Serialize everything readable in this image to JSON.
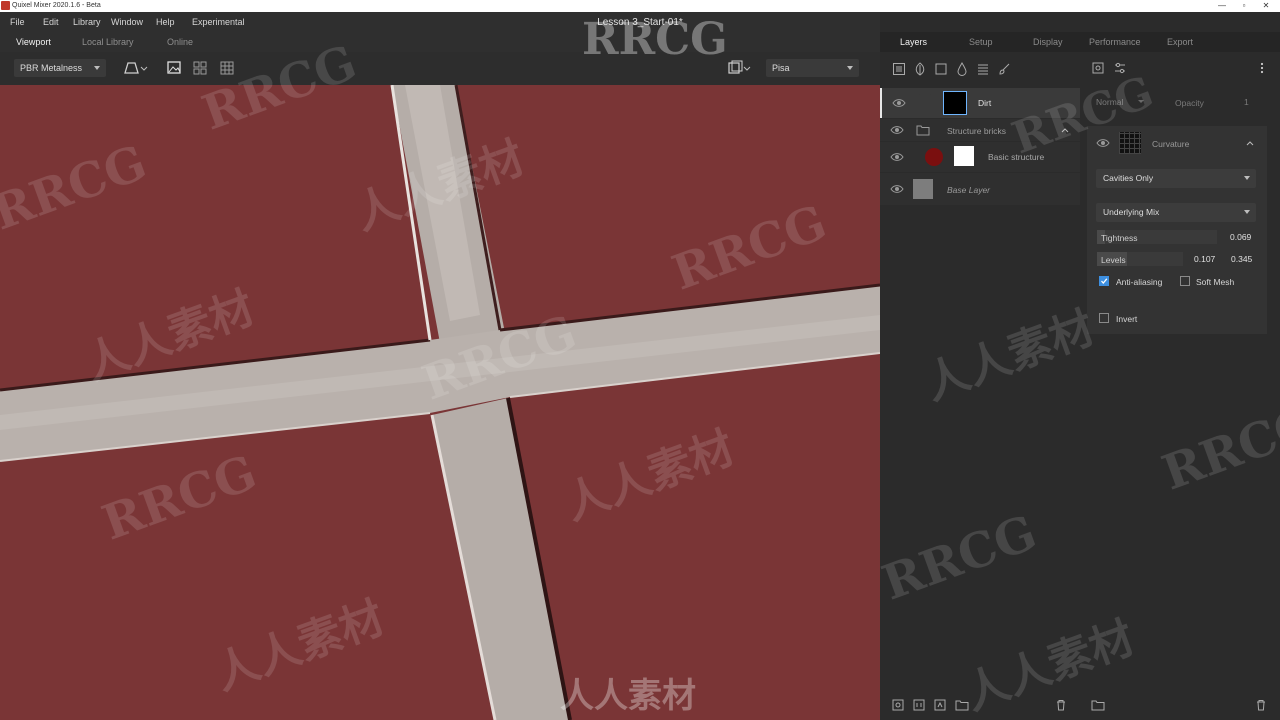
{
  "window": {
    "app_title": "Quixel Mixer 2020.1.6 - Beta",
    "document_title": "Lesson 3_Start-01*",
    "controls": [
      "—",
      "▫",
      "✕"
    ]
  },
  "menu": {
    "items": [
      "File",
      "Edit",
      "Library",
      "Window",
      "Help",
      "Experimental"
    ]
  },
  "left_tabs": {
    "items": [
      "Viewport",
      "Local Library",
      "Online"
    ],
    "active": "Viewport"
  },
  "viewport_toolbar": {
    "material_mode": "PBR Metalness",
    "environment": "Pisa",
    "icons": [
      "perspective-icon",
      "image-icon",
      "grid-small-icon",
      "grid-large-icon",
      "layout-icon"
    ]
  },
  "viewport": {
    "base_color": "#7a3536",
    "mortar_color": "#b9b1ac"
  },
  "right_tabs": {
    "items": [
      "Layers",
      "Setup",
      "Display",
      "Performance",
      "Export"
    ],
    "active": "Layers"
  },
  "layers": [
    {
      "name": "Dirt",
      "type": "layer",
      "selected": true,
      "swatch": "#3a3a3a",
      "mask": "#000000"
    },
    {
      "name": "Structure bricks",
      "type": "folder",
      "selected": false
    },
    {
      "name": "Basic structure",
      "type": "layer",
      "selected": false,
      "swatch": "#7a0f0f",
      "mask": "#ffffff"
    },
    {
      "name": "Base Layer",
      "type": "base",
      "selected": false,
      "swatch": "#7d7d7d"
    }
  ],
  "properties": {
    "blend_mode": "Normal",
    "opacity_label": "Opacity",
    "opacity_value": "1",
    "mask_component": "Curvature",
    "cavity_mode": "Cavities Only",
    "mix_mode": "Underlying Mix",
    "tightness": {
      "label": "Tightness",
      "value": "0.069",
      "fraction": 0.069
    },
    "levels": {
      "label": "Levels",
      "min": "0.107",
      "max": "0.345",
      "fraction": 0.345
    },
    "anti_aliasing": {
      "label": "Anti-aliasing",
      "checked": true
    },
    "soft_mesh": {
      "label": "Soft Mesh",
      "checked": false
    },
    "invert": {
      "label": "Invert",
      "checked": false
    }
  },
  "watermarks": {
    "latin": "RRCG",
    "cjk": "人人素材"
  },
  "colors": {
    "accent": "#3d8fe0",
    "panel": "#2b2b2b",
    "selected_row": "#3a3a3a"
  }
}
